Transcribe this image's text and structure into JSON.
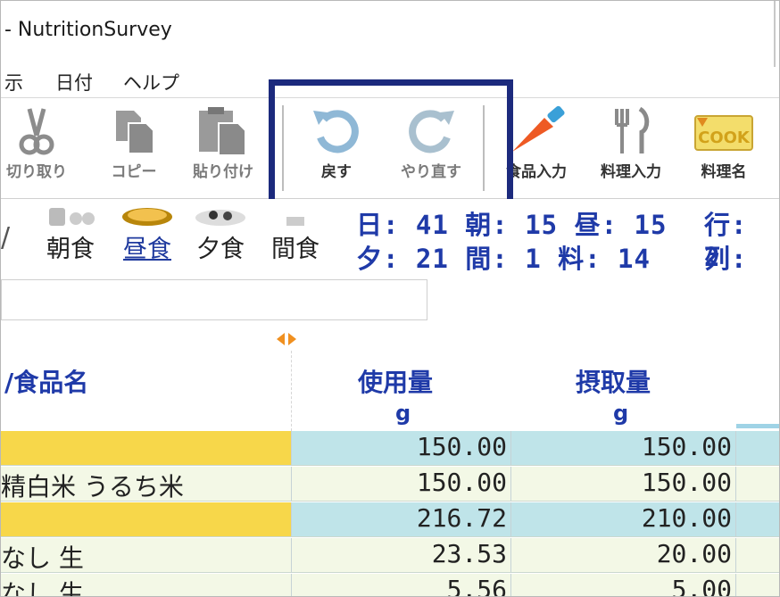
{
  "window": {
    "title": "- NutritionSurvey"
  },
  "menu": {
    "items": [
      "示",
      "日付",
      "ヘルプ"
    ]
  },
  "toolbar": {
    "cut": "切り取り",
    "copy": "コピー",
    "paste": "貼り付け",
    "undo": "戻す",
    "redo": "やり直す",
    "food_input": "食品入力",
    "dish_input": "料理入力",
    "dish_name": "料理名",
    "cook_text": "COOK"
  },
  "meals": {
    "slash": "/",
    "breakfast": "朝食",
    "lunch": "昼食",
    "dinner": "夕食",
    "snack": "間食"
  },
  "stats": {
    "line1": "日: 41 朝: 15 昼: 15",
    "line2": "夕: 21 間:  1 料: 14",
    "row_label": "行: 2",
    "col_label": "列:"
  },
  "table": {
    "headers": {
      "name": "/食品名",
      "used": "使用量",
      "intake": "摂取量",
      "used_unit": "g",
      "intake_unit": "g"
    },
    "rows": [
      {
        "name": "",
        "used": "150.00",
        "intake": "150.00",
        "type": "dish"
      },
      {
        "name": "精白米 うるち米",
        "used": "150.00",
        "intake": "150.00",
        "type": "food"
      },
      {
        "name": "",
        "used": "216.72",
        "intake": "210.00",
        "type": "dish"
      },
      {
        "name": "なし 生",
        "used": "23.53",
        "intake": "20.00",
        "type": "food"
      },
      {
        "name": "なし 生",
        "used": "5.56",
        "intake": "5.00",
        "type": "food"
      }
    ]
  },
  "colors": {
    "highlight_border": "#1c2a7d",
    "dish_name_bg": "#f7d74a",
    "dish_value_bg": "#bfe4e9",
    "food_bg": "#f3f8e6",
    "stat_text": "#1f3aa8"
  }
}
